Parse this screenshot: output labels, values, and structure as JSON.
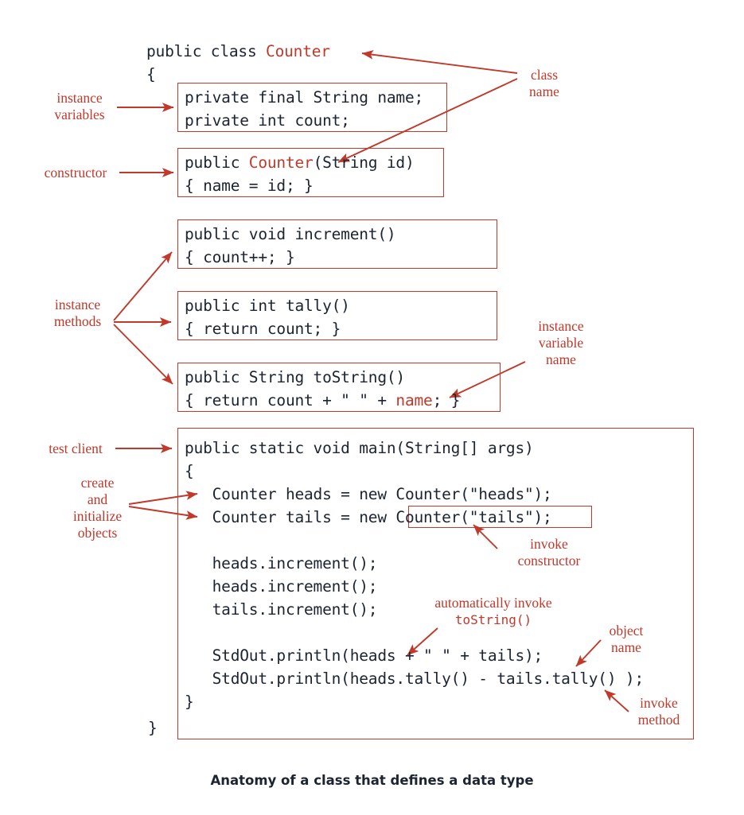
{
  "caption": "Anatomy of a class that defines a data type",
  "colors": {
    "accent_red": "#c0392b",
    "code_black": "#1b2430",
    "background": "#ffffff"
  },
  "code": {
    "class_decl_public": "public class ",
    "class_decl_name": "Counter",
    "open_brace": "{",
    "close_brace_outer": "}",
    "instance_variables": {
      "line1": "private final String name;",
      "line2": "private int count;"
    },
    "constructor": {
      "line1_pre": "public ",
      "line1_name": "Counter",
      "line1_post": "(String id)",
      "line2": "{ name = id; }"
    },
    "method_increment": {
      "line1": "public void increment()",
      "line2": "{ count++; }"
    },
    "method_tally": {
      "line1": "public int tally()",
      "line2": "{ return count; }"
    },
    "method_tostring": {
      "line1": "public String toString()",
      "line2_pre": "{ return count + \" \" + ",
      "line2_name": "name",
      "line2_post": "; }"
    },
    "main": {
      "line1": "public static void main(String[] args)",
      "line2": "{",
      "line3": "   Counter heads = new Counter(\"heads\");",
      "line4": "   Counter tails = new Counter(\"tails\");",
      "line5": "",
      "line6": "   heads.increment();",
      "line7": "   heads.increment();",
      "line8": "   tails.increment();",
      "line9": "",
      "line10": "   StdOut.println(heads + \" \" + tails);",
      "line11": "   StdOut.println(heads.tally() - tails.tally() );",
      "line12": "}"
    }
  },
  "annotations": {
    "instance_variables": "instance\nvariables",
    "constructor": "constructor",
    "instance_methods": "instance\nmethods",
    "test_client": "test client",
    "create_and_initialize_objects": "create\nand\ninitialize\nobjects",
    "class_name": "class\nname",
    "instance_variable_name": "instance\nvariable\nname",
    "invoke_constructor": "invoke\nconstructor",
    "automatically_invoke": "automatically invoke",
    "automatically_invoke_mono": "toString()",
    "object_name": "object\nname",
    "invoke_method": "invoke\nmethod"
  }
}
